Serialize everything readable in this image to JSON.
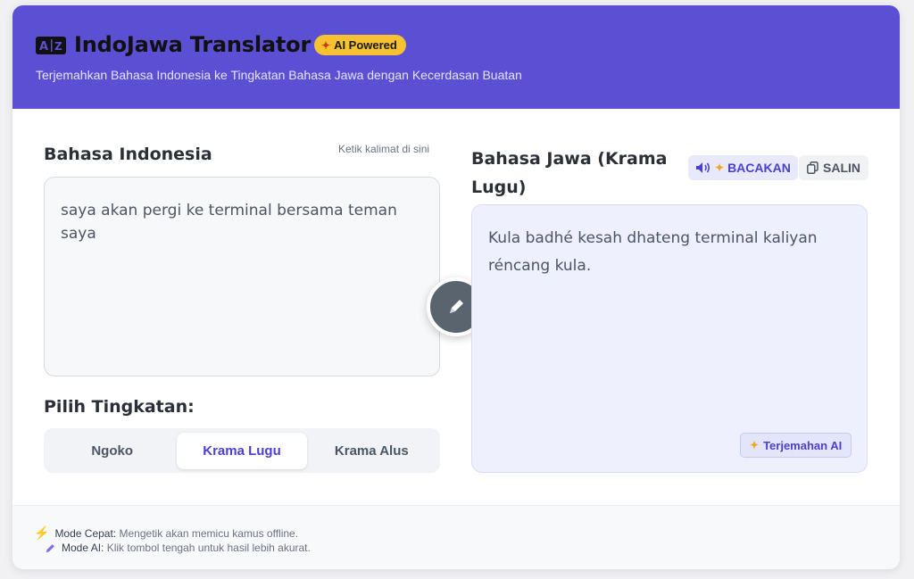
{
  "header": {
    "title": "IndoJawa Translator",
    "badge": "AI Powered",
    "subtitle": "Terjemahkan Bahasa Indonesia ke Tingkatan Bahasa Jawa dengan Kecerdasan Buatan"
  },
  "source": {
    "label": "Bahasa Indonesia",
    "hint": "Ketik kalimat di sini",
    "text": "saya akan pergi ke terminal bersama teman saya"
  },
  "levels": {
    "label": "Pilih Tingkatan:",
    "options": [
      "Ngoko",
      "Krama Lugu",
      "Krama Alus"
    ],
    "selected": "Krama Lugu"
  },
  "target": {
    "label_line1": "Bahasa Jawa (Krama",
    "label_line2": "Lugu)",
    "read_button": "BACAKAN",
    "copy_button": "SALIN",
    "text": "Kula badhé kesah dhateng terminal kaliyan réncang kula.",
    "tag": "Terjemahan AI"
  },
  "footer": {
    "fast_mode_title": "Mode Cepat:",
    "fast_mode_text": "Mengetik akan memicu kamus offline.",
    "ai_mode_title": "Mode AI:",
    "ai_mode_text": "Klik tombol tengah untuk hasil lebih akurat."
  },
  "colors": {
    "accent": "#5b4fd4",
    "badge": "#f6c232",
    "output_bg": "#eef0fd"
  },
  "icons": {
    "logo": "translate-icon",
    "badge": "sparkle-icon",
    "edit": "pencil-icon",
    "read": "speaker-icon",
    "copy": "copy-icon",
    "fast_mode": "lightning-icon",
    "ai_mode": "pencil-icon"
  }
}
